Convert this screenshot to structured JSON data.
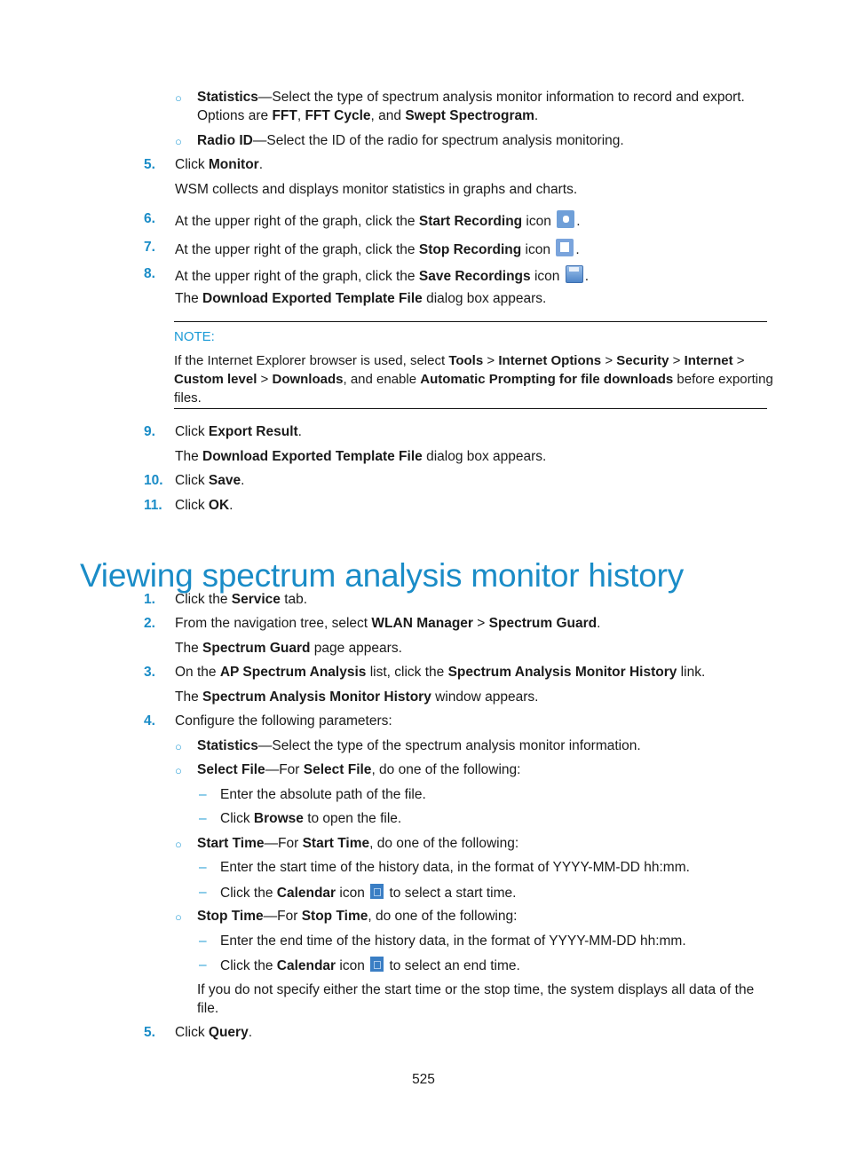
{
  "top_list": {
    "statistics_bullet": {
      "term": "Statistics",
      "text1": "—Select the type of spectrum analysis monitor information to record and export.",
      "line2_prefix": "Options are ",
      "opt1": "FFT",
      "sep1": ", ",
      "opt2": "FFT Cycle",
      "sep2": ", and ",
      "opt3": "Swept Spectrogram",
      "end": "."
    },
    "radio_bullet": {
      "term": "Radio ID",
      "text": "—Select the ID of the radio for spectrum analysis monitoring."
    },
    "steps": [
      {
        "num": "5.",
        "pre": "Click ",
        "bold": "Monitor",
        "post": ".",
        "sub": "WSM collects and displays monitor statistics in graphs and charts."
      },
      {
        "num": "6.",
        "pre": "At the upper right of the graph, click the ",
        "bold": "Start Recording",
        "post": " icon",
        "icon": "start-recording-icon",
        "end": "."
      },
      {
        "num": "7.",
        "pre": "At the upper right of the graph, click the ",
        "bold": "Stop Recording",
        "post": " icon",
        "icon": "stop-recording-icon",
        "end": "."
      },
      {
        "num": "8.",
        "pre": "At the upper right of the graph, click the ",
        "bold": "Save Recordings",
        "post": " icon",
        "icon": "save-recordings-icon",
        "end": ".",
        "sub_pre": "The ",
        "sub_bold": "Download Exported Template File",
        "sub_post": " dialog box appears."
      }
    ],
    "note": {
      "label": "NOTE:",
      "l1_a": "If the Internet Explorer browser is used, select ",
      "l1_b": "Tools",
      "l1_c": " > ",
      "l1_d": "Internet Options",
      "l1_e": " > ",
      "l1_f": "Security",
      "l1_g": " > ",
      "l1_h": "Internet",
      "l1_i": " >",
      "l2_a": "Custom level",
      "l2_b": " > ",
      "l2_c": "Downloads",
      "l2_d": ", and enable ",
      "l2_e": "Automatic Prompting for file downloads",
      "l2_f": " before exporting",
      "l3": "files."
    },
    "steps2": [
      {
        "num": "9.",
        "pre": "Click ",
        "bold": "Export Result",
        "post": ".",
        "sub_pre": "The ",
        "sub_bold": "Download Exported Template File",
        "sub_post": " dialog box appears."
      },
      {
        "num": "10.",
        "pre": "Click ",
        "bold": "Save",
        "post": "."
      },
      {
        "num": "11.",
        "pre": "Click ",
        "bold": "OK",
        "post": "."
      }
    ]
  },
  "section": {
    "title": "Viewing spectrum analysis monitor history",
    "steps": [
      {
        "num": "1.",
        "pre": "Click the ",
        "bold": "Service",
        "post": " tab."
      },
      {
        "num": "2.",
        "pre": "From the navigation tree, select ",
        "bold": "WLAN Manager",
        "mid": " > ",
        "bold2": "Spectrum Guard",
        "post": ".",
        "sub_pre": "The ",
        "sub_bold": "Spectrum Guard",
        "sub_post": " page appears."
      },
      {
        "num": "3.",
        "pre": "On the ",
        "bold": "AP Spectrum Analysis",
        "mid": " list, click the ",
        "bold2": "Spectrum Analysis Monitor History",
        "post": " link.",
        "sub_pre": "The ",
        "sub_bold": "Spectrum Analysis Monitor History",
        "sub_post": " window appears."
      },
      {
        "num": "4.",
        "text": "Configure the following parameters:"
      },
      {
        "num": "5.",
        "pre": "Click ",
        "bold": "Query",
        "post": "."
      }
    ],
    "params": {
      "statistics": {
        "term": "Statistics",
        "text": "—Select the type of the spectrum analysis monitor information."
      },
      "select_file": {
        "term": "Select File",
        "mid": "—For ",
        "term2": "Select File",
        "post": ", do one of the following:",
        "items": [
          {
            "text": "Enter the absolute path of the file."
          },
          {
            "pre": "Click ",
            "bold": "Browse",
            "post": " to open the file."
          }
        ]
      },
      "start_time": {
        "term": "Start Time",
        "mid": "—For ",
        "term2": "Start Time",
        "post": ", do one of the following:",
        "items": [
          {
            "text": "Enter the start time of the history data, in the format of YYYY-MM-DD hh:mm."
          },
          {
            "pre": "Click the ",
            "bold": "Calendar",
            "post": " icon",
            "icon": "calendar-icon",
            "end": " to select a start time."
          }
        ]
      },
      "stop_time": {
        "term": "Stop Time",
        "mid": "—For ",
        "term2": "Stop Time",
        "post": ", do one of the following:",
        "items": [
          {
            "text": "Enter the end time of the history data, in the format of YYYY-MM-DD hh:mm."
          },
          {
            "pre": "Click the ",
            "bold": "Calendar",
            "post": " icon",
            "icon": "calendar-icon",
            "end": " to select an end time."
          }
        ]
      },
      "note_l1": "If you do not specify either the start time or the stop time, the system displays all data of the",
      "note_l2": "file."
    }
  },
  "footer": {
    "page_number": "525"
  }
}
